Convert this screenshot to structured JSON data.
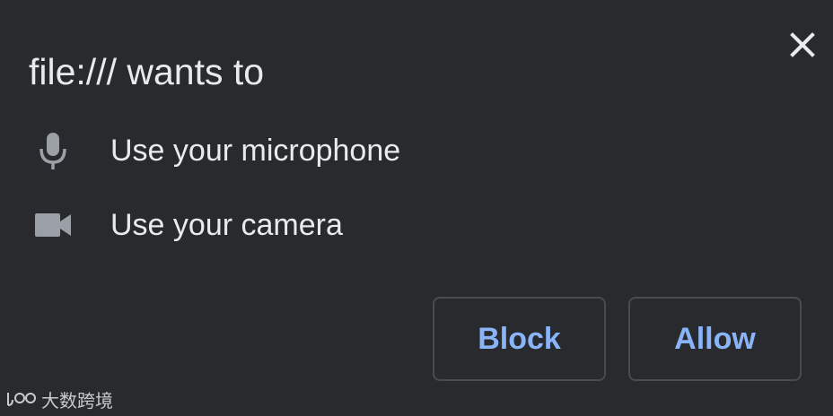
{
  "dialog": {
    "title": "file:/// wants to",
    "close_icon": "close-icon",
    "permissions": [
      {
        "icon": "microphone-icon",
        "label": "Use your microphone"
      },
      {
        "icon": "camera-icon",
        "label": "Use your camera"
      }
    ],
    "buttons": {
      "block_label": "Block",
      "allow_label": "Allow"
    }
  },
  "watermark": {
    "text": "大数跨境"
  },
  "colors": {
    "background": "#292a2d",
    "text": "#e8eaed",
    "icon": "#9aa0a6",
    "button_text": "#8ab4f8",
    "button_border": "#4a4b4f"
  }
}
